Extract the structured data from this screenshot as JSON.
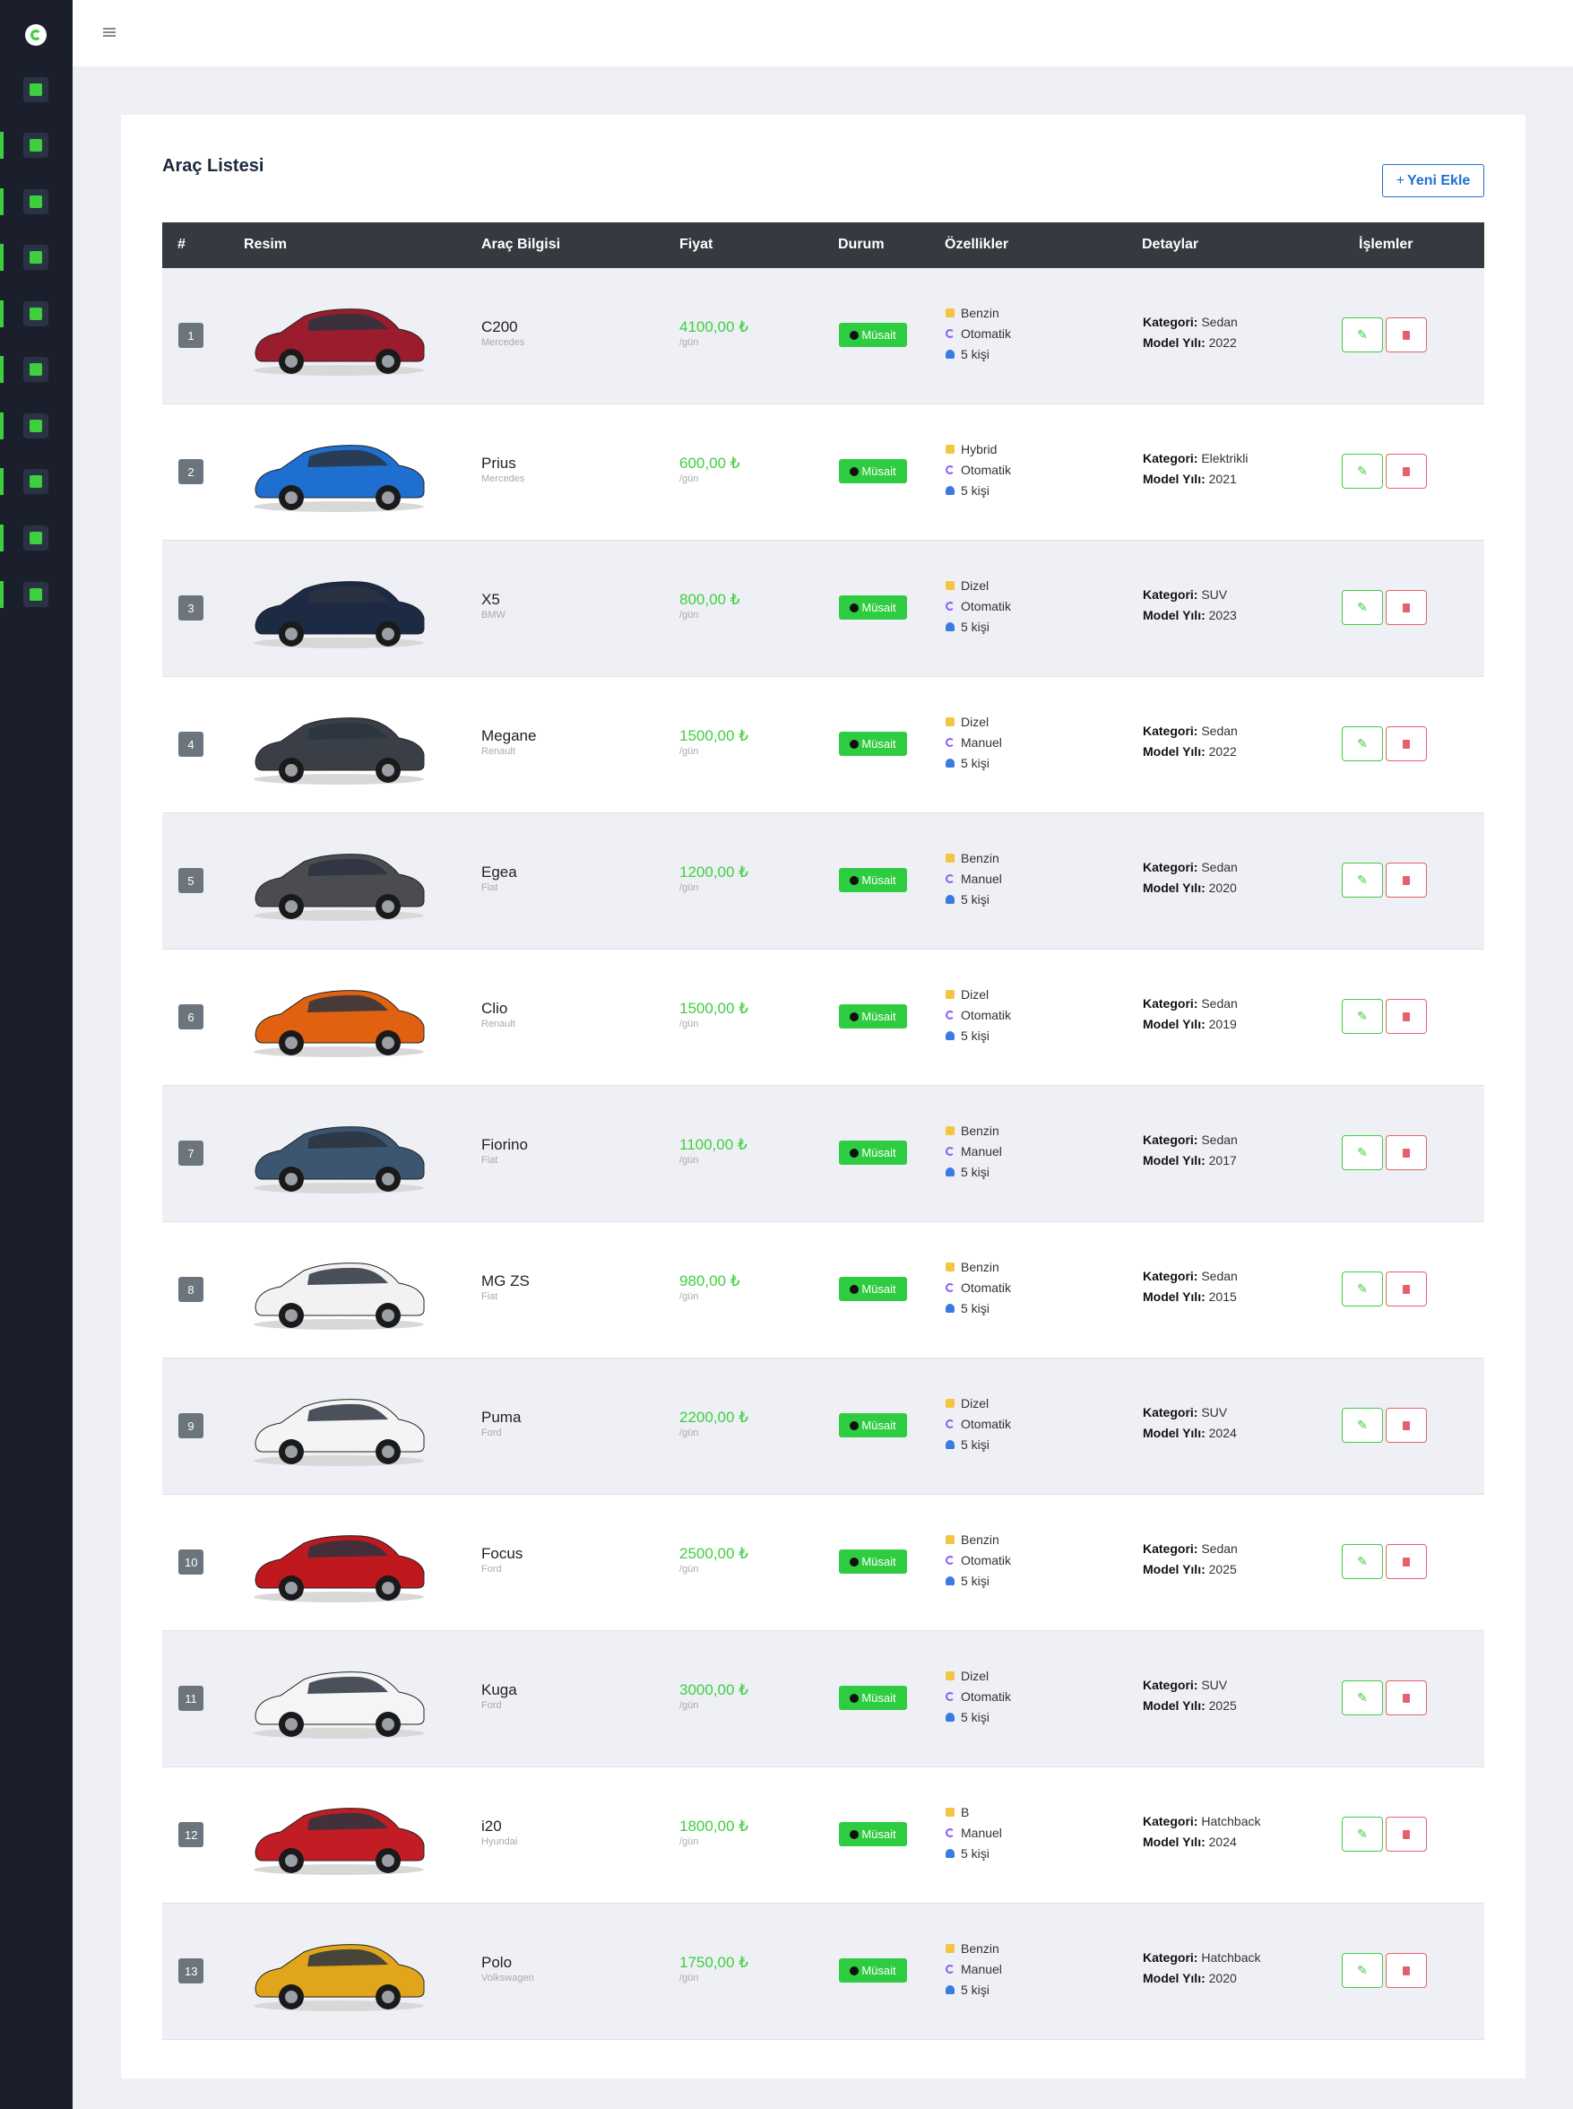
{
  "header": {
    "menu_icon": "hamburger-icon"
  },
  "sidebar": {
    "logo_icon": "logo-c-icon",
    "items": [
      {
        "icon": "dashboard-icon",
        "active": false
      },
      {
        "icon": "tag-icon",
        "active": true
      },
      {
        "icon": "car-icon",
        "active": true
      },
      {
        "icon": "command-icon",
        "active": true
      },
      {
        "icon": "user-icon",
        "active": true
      },
      {
        "icon": "message-icon",
        "active": true
      },
      {
        "icon": "calendar-icon",
        "active": true
      },
      {
        "icon": "image-icon",
        "active": true
      },
      {
        "icon": "location-icon",
        "active": true
      },
      {
        "icon": "info-icon",
        "active": true
      }
    ]
  },
  "main": {
    "title": "Araç Listesi",
    "add_button": "Yeni Ekle",
    "columns": [
      "#",
      "Resim",
      "Araç Bilgisi",
      "Fiyat",
      "Durum",
      "Özellikler",
      "Detaylar",
      "İşlemler"
    ],
    "detail_labels": {
      "category": "Kategori:",
      "year": "Model Yılı:"
    },
    "per_day": "/gün",
    "rows": [
      {
        "num": "1",
        "name": "C200",
        "brand": "Mercedes",
        "price": "4100,00 ₺",
        "status": "Müsait",
        "fuel": "Benzin",
        "gear": "Otomatik",
        "seats": "5 kişi",
        "category": "Sedan",
        "year": "2022",
        "car_color": "#9b1c2c"
      },
      {
        "num": "2",
        "name": "Prius",
        "brand": "Mercedes",
        "price": "600,00 ₺",
        "status": "Müsait",
        "fuel": "Hybrid",
        "gear": "Otomatik",
        "seats": "5 kişi",
        "category": "Elektrikli",
        "year": "2021",
        "car_color": "#1e6fd0"
      },
      {
        "num": "3",
        "name": "X5",
        "brand": "BMW",
        "price": "800,00 ₺",
        "status": "Müsait",
        "fuel": "Dizel",
        "gear": "Otomatik",
        "seats": "5 kişi",
        "category": "SUV",
        "year": "2023",
        "car_color": "#1d2a44"
      },
      {
        "num": "4",
        "name": "Megane",
        "brand": "Renault",
        "price": "1500,00 ₺",
        "status": "Müsait",
        "fuel": "Dizel",
        "gear": "Manuel",
        "seats": "5 kişi",
        "category": "Sedan",
        "year": "2022",
        "car_color": "#3a3f47"
      },
      {
        "num": "5",
        "name": "Egea",
        "brand": "Fiat",
        "price": "1200,00 ₺",
        "status": "Müsait",
        "fuel": "Benzin",
        "gear": "Manuel",
        "seats": "5 kişi",
        "category": "Sedan",
        "year": "2020",
        "car_color": "#4a4c50"
      },
      {
        "num": "6",
        "name": "Clio",
        "brand": "Renault",
        "price": "1500,00 ₺",
        "status": "Müsait",
        "fuel": "Dizel",
        "gear": "Otomatik",
        "seats": "5 kişi",
        "category": "Sedan",
        "year": "2019",
        "car_color": "#e0610f"
      },
      {
        "num": "7",
        "name": "Fiorino",
        "brand": "Fiat",
        "price": "1100,00 ₺",
        "status": "Müsait",
        "fuel": "Benzin",
        "gear": "Manuel",
        "seats": "5 kişi",
        "category": "Sedan",
        "year": "2017",
        "car_color": "#3c5570"
      },
      {
        "num": "8",
        "name": "MG ZS",
        "brand": "Fiat",
        "price": "980,00 ₺",
        "status": "Müsait",
        "fuel": "Benzin",
        "gear": "Otomatik",
        "seats": "5 kişi",
        "category": "Sedan",
        "year": "2015",
        "car_color": "#f2f2f2"
      },
      {
        "num": "9",
        "name": "Puma",
        "brand": "Ford",
        "price": "2200,00 ₺",
        "status": "Müsait",
        "fuel": "Dizel",
        "gear": "Otomatik",
        "seats": "5 kişi",
        "category": "SUV",
        "year": "2024",
        "car_color": "#f4f4f4"
      },
      {
        "num": "10",
        "name": "Focus",
        "brand": "Ford",
        "price": "2500,00 ₺",
        "status": "Müsait",
        "fuel": "Benzin",
        "gear": "Otomatik",
        "seats": "5 kişi",
        "category": "Sedan",
        "year": "2025",
        "car_color": "#c0181f"
      },
      {
        "num": "11",
        "name": "Kuga",
        "brand": "Ford",
        "price": "3000,00 ₺",
        "status": "Müsait",
        "fuel": "Dizel",
        "gear": "Otomatik",
        "seats": "5 kişi",
        "category": "SUV",
        "year": "2025",
        "car_color": "#f5f5f5"
      },
      {
        "num": "12",
        "name": "i20",
        "brand": "Hyundai",
        "price": "1800,00 ₺",
        "status": "Müsait",
        "fuel": "B",
        "gear": "Manuel",
        "seats": "5 kişi",
        "category": "Hatchback",
        "year": "2024",
        "car_color": "#c21c24"
      },
      {
        "num": "13",
        "name": "Polo",
        "brand": "Volkswagen",
        "price": "1750,00 ₺",
        "status": "Müsait",
        "fuel": "Benzin",
        "gear": "Manuel",
        "seats": "5 kişi",
        "category": "Hatchback",
        "year": "2020",
        "car_color": "#e0a51a"
      }
    ]
  },
  "colors": {
    "accent": "#3ecf3e",
    "sidebar": "#1b1f2b",
    "primary": "#1b6fd3",
    "danger": "#e4606d"
  }
}
